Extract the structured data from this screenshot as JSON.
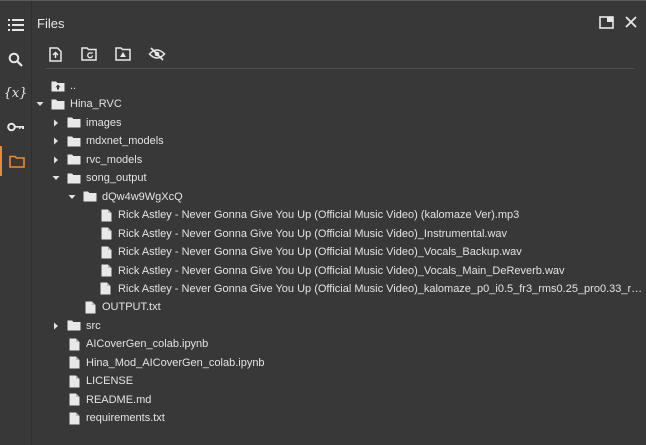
{
  "panel": {
    "title": "Files"
  },
  "rail": {
    "items": [
      {
        "icon": "table-of-contents-icon"
      },
      {
        "icon": "search-icon"
      },
      {
        "icon": "variables-icon",
        "text": "{x}"
      },
      {
        "icon": "key-icon"
      },
      {
        "icon": "folder-icon",
        "active": true
      }
    ]
  },
  "toolbar": {
    "items": [
      "upload-file-icon",
      "refresh-icon",
      "mount-drive-icon",
      "hide-hidden-files-icon"
    ]
  },
  "colors": {
    "accent": "#ef8a2c",
    "background": "#383838",
    "text": "#e3e3e3"
  },
  "tree": [
    {
      "label": "..",
      "type": "parent",
      "depth": 0,
      "chevron": "none"
    },
    {
      "label": "Hina_RVC",
      "type": "folder",
      "depth": 0,
      "chevron": "down"
    },
    {
      "label": "images",
      "type": "folder",
      "depth": 1,
      "chevron": "right"
    },
    {
      "label": "mdxnet_models",
      "type": "folder",
      "depth": 1,
      "chevron": "right"
    },
    {
      "label": "rvc_models",
      "type": "folder",
      "depth": 1,
      "chevron": "right"
    },
    {
      "label": "song_output",
      "type": "folder",
      "depth": 1,
      "chevron": "down"
    },
    {
      "label": "dQw4w9WgXcQ",
      "type": "folder",
      "depth": 2,
      "chevron": "down"
    },
    {
      "label": "Rick Astley - Never Gonna Give You Up (Official Music Video) (kalomaze Ver).mp3",
      "type": "file",
      "depth": 3,
      "chevron": "none"
    },
    {
      "label": "Rick Astley - Never Gonna Give You Up (Official Music Video)_Instrumental.wav",
      "type": "file",
      "depth": 3,
      "chevron": "none"
    },
    {
      "label": "Rick Astley - Never Gonna Give You Up (Official Music Video)_Vocals_Backup.wav",
      "type": "file",
      "depth": 3,
      "chevron": "none"
    },
    {
      "label": "Rick Astley - Never Gonna Give You Up (Official Music Video)_Vocals_Main_DeReverb.wav",
      "type": "file",
      "depth": 3,
      "chevron": "none"
    },
    {
      "label": "Rick Astley - Never Gonna Give You Up (Official Music Video)_kalomaze_p0_i0.5_fr3_rms0.25_pro0.33_rm...",
      "type": "file",
      "depth": 3,
      "chevron": "none"
    },
    {
      "label": "OUTPUT.txt",
      "type": "file",
      "depth": 2,
      "chevron": "none"
    },
    {
      "label": "src",
      "type": "folder",
      "depth": 1,
      "chevron": "right"
    },
    {
      "label": "AICoverGen_colab.ipynb",
      "type": "file",
      "depth": 1,
      "chevron": "none"
    },
    {
      "label": "Hina_Mod_AICoverGen_colab.ipynb",
      "type": "file",
      "depth": 1,
      "chevron": "none"
    },
    {
      "label": "LICENSE",
      "type": "file",
      "depth": 1,
      "chevron": "none"
    },
    {
      "label": "README.md",
      "type": "file",
      "depth": 1,
      "chevron": "none"
    },
    {
      "label": "requirements.txt",
      "type": "file",
      "depth": 1,
      "chevron": "none"
    }
  ]
}
